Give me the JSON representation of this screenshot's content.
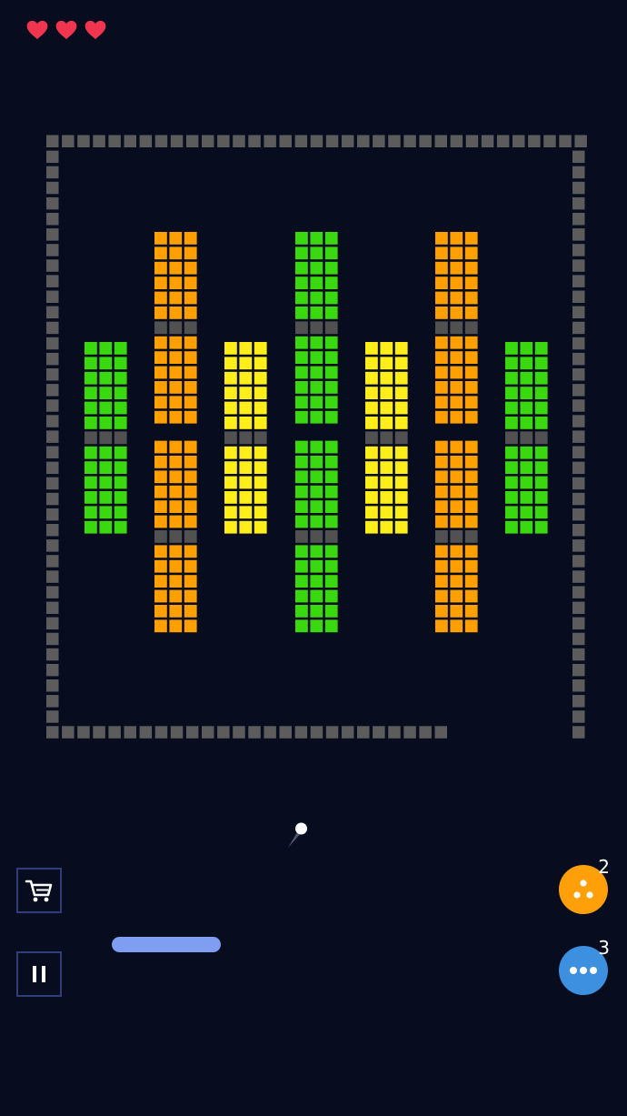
{
  "hud": {
    "lives": 3,
    "heart_color": "#f0364f"
  },
  "colors": {
    "background": "#070d1e",
    "border_block": "#5c5c5c",
    "orange": "#ff9f00",
    "green": "#3ad80f",
    "yellow": "#ffee1a",
    "gray": "#515151",
    "paddle": "#7f9ef2",
    "ball": "#ffffff"
  },
  "board": {
    "columns": [
      {
        "color": "green",
        "rows": [
          "b",
          "b",
          "b",
          "b",
          "b",
          "b",
          "g",
          "b",
          "b",
          "b",
          "b",
          "b",
          "b"
        ]
      },
      {
        "color": "orange",
        "rows": [
          "b",
          "b",
          "b",
          "b",
          "b",
          "b",
          "g",
          "b",
          "b",
          "b",
          "b",
          "b",
          "b",
          "-",
          "b",
          "b",
          "b",
          "b",
          "b",
          "b",
          "g",
          "b",
          "b",
          "b",
          "b",
          "b",
          "b"
        ]
      },
      {
        "color": "yellow",
        "rows": [
          "b",
          "b",
          "b",
          "b",
          "b",
          "b",
          "g",
          "b",
          "b",
          "b",
          "b",
          "b",
          "b"
        ]
      },
      {
        "color": "green",
        "rows": [
          "b",
          "b",
          "b",
          "b",
          "b",
          "b",
          "g",
          "b",
          "b",
          "b",
          "b",
          "b",
          "b",
          "-",
          "b",
          "b",
          "b",
          "b",
          "b",
          "b",
          "g",
          "b",
          "b",
          "b",
          "b",
          "b",
          "b"
        ]
      },
      {
        "color": "yellow",
        "rows": [
          "b",
          "b",
          "b",
          "b",
          "b",
          "b",
          "g",
          "b",
          "b",
          "b",
          "b",
          "b",
          "b"
        ]
      },
      {
        "color": "orange",
        "rows": [
          "b",
          "b",
          "b",
          "b",
          "b",
          "b",
          "g",
          "b",
          "b",
          "b",
          "b",
          "b",
          "b",
          "-",
          "b",
          "b",
          "b",
          "b",
          "b",
          "b",
          "g",
          "b",
          "b",
          "b",
          "b",
          "b",
          "b"
        ]
      },
      {
        "color": "green",
        "rows": [
          "b",
          "b",
          "b",
          "b",
          "b",
          "b",
          "g",
          "b",
          "b",
          "b",
          "b",
          "b",
          "b"
        ]
      }
    ]
  },
  "controls": {
    "shop_icon": "cart-icon",
    "pause_icon": "pause-icon"
  },
  "powerups": [
    {
      "name": "multi-ball",
      "icon": "three-dots-triangle-icon",
      "color": "#ff9f0a",
      "count": "2"
    },
    {
      "name": "triple-shot",
      "icon": "three-dots-row-icon",
      "color": "#3d8fe0",
      "count": "3"
    }
  ]
}
